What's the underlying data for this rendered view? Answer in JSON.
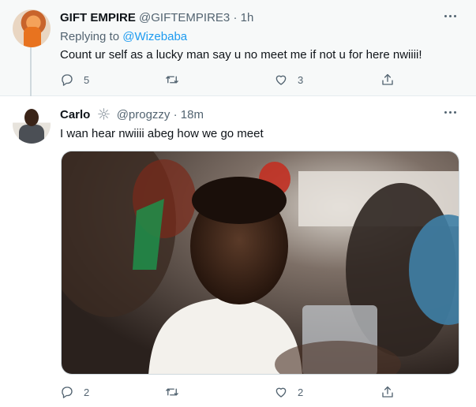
{
  "tweets": [
    {
      "display_name": "GIFT EMPIRE",
      "handle": "@GIFTEMPIRE3",
      "dot": "·",
      "time": "1h",
      "reply_prefix": "Replying to",
      "reply_to": "@Wizebaba",
      "text": "Count ur self as a lucky man say u no meet me if not u for here nwiiii!",
      "reply_count": "5",
      "retweet_count": "",
      "like_count": "3"
    },
    {
      "display_name": "Carlo",
      "handle": "@progzzy",
      "dot": "·",
      "time": "18m",
      "text": "I wan hear nwiiii abeg how we go meet",
      "reply_count": "2",
      "retweet_count": "",
      "like_count": "2"
    }
  ],
  "icons": {
    "reply": "reply-icon",
    "retweet": "retweet-icon",
    "like": "heart-icon",
    "share": "share-icon",
    "more": "more-icon",
    "badge": "sparkle-badge-icon"
  },
  "colors": {
    "link": "#1d9bf0",
    "secondary_text": "#536471",
    "thread_line": "#cfd9de",
    "highlighted_bg": "#f7f9f9"
  }
}
